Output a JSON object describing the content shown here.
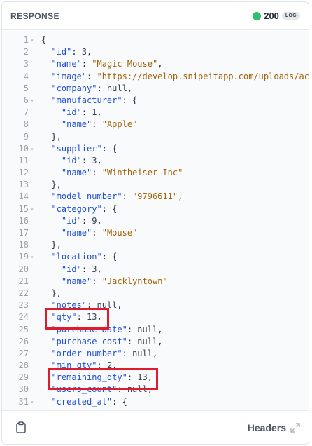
{
  "panel": {
    "title": "RESPONSE",
    "status_code": "200",
    "log_badge": "LOG",
    "status_color": "#2fbf71"
  },
  "code": {
    "lines": [
      {
        "n": "1",
        "fold": true,
        "parts": [
          [
            "p",
            "{"
          ]
        ]
      },
      {
        "n": "2",
        "fold": false,
        "parts": [
          [
            "p",
            "  "
          ],
          [
            "k",
            "\"id\""
          ],
          [
            "p",
            ": "
          ],
          [
            "n",
            "3"
          ],
          [
            "p",
            ","
          ]
        ]
      },
      {
        "n": "3",
        "fold": false,
        "parts": [
          [
            "p",
            "  "
          ],
          [
            "k",
            "\"name\""
          ],
          [
            "p",
            ": "
          ],
          [
            "s",
            "\"Magic Mouse\""
          ],
          [
            "p",
            ","
          ]
        ]
      },
      {
        "n": "4",
        "fold": false,
        "parts": [
          [
            "p",
            "  "
          ],
          [
            "k",
            "\"image\""
          ],
          [
            "p",
            ": "
          ],
          [
            "s",
            "\"https://develop.snipeitapp.com/uploads/acc"
          ]
        ]
      },
      {
        "n": "5",
        "fold": false,
        "parts": [
          [
            "p",
            "  "
          ],
          [
            "k",
            "\"company\""
          ],
          [
            "p",
            ": "
          ],
          [
            "n",
            "null"
          ],
          [
            "p",
            ","
          ]
        ]
      },
      {
        "n": "6",
        "fold": true,
        "parts": [
          [
            "p",
            "  "
          ],
          [
            "k",
            "\"manufacturer\""
          ],
          [
            "p",
            ": {"
          ]
        ]
      },
      {
        "n": "7",
        "fold": false,
        "parts": [
          [
            "p",
            "    "
          ],
          [
            "k",
            "\"id\""
          ],
          [
            "p",
            ": "
          ],
          [
            "n",
            "1"
          ],
          [
            "p",
            ","
          ]
        ]
      },
      {
        "n": "8",
        "fold": false,
        "parts": [
          [
            "p",
            "    "
          ],
          [
            "k",
            "\"name\""
          ],
          [
            "p",
            ": "
          ],
          [
            "s",
            "\"Apple\""
          ]
        ]
      },
      {
        "n": "9",
        "fold": false,
        "parts": [
          [
            "p",
            "  },"
          ]
        ]
      },
      {
        "n": "10",
        "fold": true,
        "parts": [
          [
            "p",
            "  "
          ],
          [
            "k",
            "\"supplier\""
          ],
          [
            "p",
            ": {"
          ]
        ]
      },
      {
        "n": "11",
        "fold": false,
        "parts": [
          [
            "p",
            "    "
          ],
          [
            "k",
            "\"id\""
          ],
          [
            "p",
            ": "
          ],
          [
            "n",
            "3"
          ],
          [
            "p",
            ","
          ]
        ]
      },
      {
        "n": "12",
        "fold": false,
        "parts": [
          [
            "p",
            "    "
          ],
          [
            "k",
            "\"name\""
          ],
          [
            "p",
            ": "
          ],
          [
            "s",
            "\"Wintheiser Inc\""
          ]
        ]
      },
      {
        "n": "13",
        "fold": false,
        "parts": [
          [
            "p",
            "  },"
          ]
        ]
      },
      {
        "n": "14",
        "fold": false,
        "parts": [
          [
            "p",
            "  "
          ],
          [
            "k",
            "\"model_number\""
          ],
          [
            "p",
            ": "
          ],
          [
            "s",
            "\"9796611\""
          ],
          [
            "p",
            ","
          ]
        ]
      },
      {
        "n": "15",
        "fold": true,
        "parts": [
          [
            "p",
            "  "
          ],
          [
            "k",
            "\"category\""
          ],
          [
            "p",
            ": {"
          ]
        ]
      },
      {
        "n": "16",
        "fold": false,
        "parts": [
          [
            "p",
            "    "
          ],
          [
            "k",
            "\"id\""
          ],
          [
            "p",
            ": "
          ],
          [
            "n",
            "9"
          ],
          [
            "p",
            ","
          ]
        ]
      },
      {
        "n": "17",
        "fold": false,
        "parts": [
          [
            "p",
            "    "
          ],
          [
            "k",
            "\"name\""
          ],
          [
            "p",
            ": "
          ],
          [
            "s",
            "\"Mouse\""
          ]
        ]
      },
      {
        "n": "18",
        "fold": false,
        "parts": [
          [
            "p",
            "  },"
          ]
        ]
      },
      {
        "n": "19",
        "fold": true,
        "parts": [
          [
            "p",
            "  "
          ],
          [
            "k",
            "\"location\""
          ],
          [
            "p",
            ": {"
          ]
        ]
      },
      {
        "n": "20",
        "fold": false,
        "parts": [
          [
            "p",
            "    "
          ],
          [
            "k",
            "\"id\""
          ],
          [
            "p",
            ": "
          ],
          [
            "n",
            "3"
          ],
          [
            "p",
            ","
          ]
        ]
      },
      {
        "n": "21",
        "fold": false,
        "parts": [
          [
            "p",
            "    "
          ],
          [
            "k",
            "\"name\""
          ],
          [
            "p",
            ": "
          ],
          [
            "s",
            "\"Jacklyntown\""
          ]
        ]
      },
      {
        "n": "22",
        "fold": false,
        "parts": [
          [
            "p",
            "  },"
          ]
        ]
      },
      {
        "n": "23",
        "fold": false,
        "parts": [
          [
            "p",
            "  "
          ],
          [
            "k",
            "\"notes\""
          ],
          [
            "p",
            ": "
          ],
          [
            "n",
            "null"
          ],
          [
            "p",
            ","
          ]
        ]
      },
      {
        "n": "24",
        "fold": false,
        "parts": [
          [
            "p",
            "  "
          ],
          [
            "k",
            "\"qty\""
          ],
          [
            "p",
            ": "
          ],
          [
            "n",
            "13"
          ],
          [
            "p",
            ","
          ]
        ]
      },
      {
        "n": "25",
        "fold": false,
        "parts": [
          [
            "p",
            "  "
          ],
          [
            "k",
            "\"purchase_date\""
          ],
          [
            "p",
            ": "
          ],
          [
            "n",
            "null"
          ],
          [
            "p",
            ","
          ]
        ]
      },
      {
        "n": "26",
        "fold": false,
        "parts": [
          [
            "p",
            "  "
          ],
          [
            "k",
            "\"purchase_cost\""
          ],
          [
            "p",
            ": "
          ],
          [
            "n",
            "null"
          ],
          [
            "p",
            ","
          ]
        ]
      },
      {
        "n": "27",
        "fold": false,
        "parts": [
          [
            "p",
            "  "
          ],
          [
            "k",
            "\"order_number\""
          ],
          [
            "p",
            ": "
          ],
          [
            "n",
            "null"
          ],
          [
            "p",
            ","
          ]
        ]
      },
      {
        "n": "28",
        "fold": false,
        "parts": [
          [
            "p",
            "  "
          ],
          [
            "k",
            "\"min_qty\""
          ],
          [
            "p",
            ": "
          ],
          [
            "n",
            "2"
          ],
          [
            "p",
            ","
          ]
        ]
      },
      {
        "n": "29",
        "fold": false,
        "parts": [
          [
            "p",
            "  "
          ],
          [
            "k",
            "\"remaining_qty\""
          ],
          [
            "p",
            ": "
          ],
          [
            "n",
            "13"
          ],
          [
            "p",
            ","
          ]
        ]
      },
      {
        "n": "30",
        "fold": false,
        "parts": [
          [
            "p",
            "  "
          ],
          [
            "k",
            "\"users_count\""
          ],
          [
            "p",
            ": "
          ],
          [
            "n",
            "null"
          ],
          [
            "p",
            ","
          ]
        ]
      },
      {
        "n": "31",
        "fold": true,
        "parts": [
          [
            "p",
            "  "
          ],
          [
            "k",
            "\"created_at\""
          ],
          [
            "p",
            ": {"
          ]
        ]
      }
    ],
    "highlighted_lines": [
      "24",
      "29"
    ],
    "highlight_color": "#dd1d2f"
  },
  "footer": {
    "copy_icon": "clipboard-icon",
    "headers_label": "Headers",
    "expand_icon": "expand-arrows-icon"
  }
}
